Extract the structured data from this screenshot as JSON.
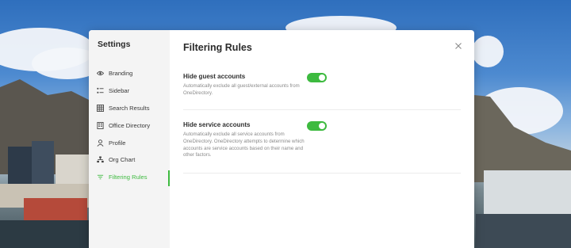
{
  "sidebar": {
    "title": "Settings",
    "items": [
      {
        "label": "Branding",
        "icon": "eye-icon"
      },
      {
        "label": "Sidebar",
        "icon": "list-icon"
      },
      {
        "label": "Search Results",
        "icon": "grid-icon"
      },
      {
        "label": "Office Directory",
        "icon": "building-icon"
      },
      {
        "label": "Profile",
        "icon": "person-icon"
      },
      {
        "label": "Org Chart",
        "icon": "org-chart-icon"
      },
      {
        "label": "Filtering Rules",
        "icon": "filter-icon",
        "active": true
      }
    ]
  },
  "main": {
    "title": "Filtering Rules",
    "rules": [
      {
        "title": "Hide guest accounts",
        "description": "Automatically exclude all guest/external accounts from OneDirectory.",
        "enabled": true
      },
      {
        "title": "Hide service accounts",
        "description": "Automatically exclude all service accounts from OneDirectory. OneDirectory attempts to determine which accounts are service accounts based on their name and other factors.",
        "enabled": true
      }
    ]
  },
  "colors": {
    "accent": "#3dba3f",
    "sidebar_bg": "#f4f4f4"
  }
}
